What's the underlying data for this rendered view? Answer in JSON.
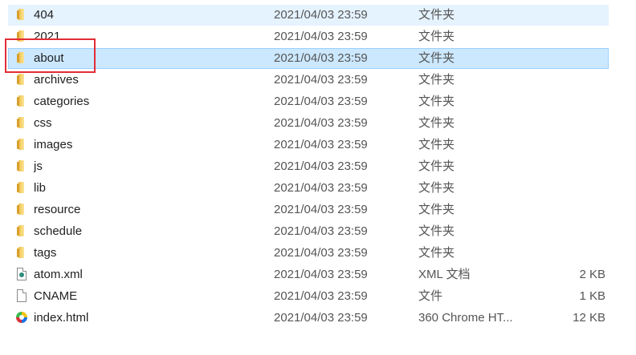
{
  "files": [
    {
      "name": "404",
      "date": "2021/04/03 23:59",
      "type": "文件夹",
      "size": "",
      "icon": "folder-icon",
      "state": "hover"
    },
    {
      "name": "2021",
      "date": "2021/04/03 23:59",
      "type": "文件夹",
      "size": "",
      "icon": "folder-icon",
      "state": ""
    },
    {
      "name": "about",
      "date": "2021/04/03 23:59",
      "type": "文件夹",
      "size": "",
      "icon": "folder-icon",
      "state": "selected"
    },
    {
      "name": "archives",
      "date": "2021/04/03 23:59",
      "type": "文件夹",
      "size": "",
      "icon": "folder-icon",
      "state": ""
    },
    {
      "name": "categories",
      "date": "2021/04/03 23:59",
      "type": "文件夹",
      "size": "",
      "icon": "folder-icon",
      "state": ""
    },
    {
      "name": "css",
      "date": "2021/04/03 23:59",
      "type": "文件夹",
      "size": "",
      "icon": "folder-icon",
      "state": ""
    },
    {
      "name": "images",
      "date": "2021/04/03 23:59",
      "type": "文件夹",
      "size": "",
      "icon": "folder-icon",
      "state": ""
    },
    {
      "name": "js",
      "date": "2021/04/03 23:59",
      "type": "文件夹",
      "size": "",
      "icon": "folder-icon",
      "state": ""
    },
    {
      "name": "lib",
      "date": "2021/04/03 23:59",
      "type": "文件夹",
      "size": "",
      "icon": "folder-icon",
      "state": ""
    },
    {
      "name": "resource",
      "date": "2021/04/03 23:59",
      "type": "文件夹",
      "size": "",
      "icon": "folder-icon",
      "state": ""
    },
    {
      "name": "schedule",
      "date": "2021/04/03 23:59",
      "type": "文件夹",
      "size": "",
      "icon": "folder-icon",
      "state": ""
    },
    {
      "name": "tags",
      "date": "2021/04/03 23:59",
      "type": "文件夹",
      "size": "",
      "icon": "folder-icon",
      "state": ""
    },
    {
      "name": "atom.xml",
      "date": "2021/04/03 23:59",
      "type": "XML 文档",
      "size": "2 KB",
      "icon": "xml-file-icon",
      "state": ""
    },
    {
      "name": "CNAME",
      "date": "2021/04/03 23:59",
      "type": "文件",
      "size": "1 KB",
      "icon": "file-icon",
      "state": ""
    },
    {
      "name": "index.html",
      "date": "2021/04/03 23:59",
      "type": "360 Chrome HT...",
      "size": "12 KB",
      "icon": "chrome-html-icon",
      "state": ""
    }
  ],
  "colors": {
    "selected_background": "#cce8ff",
    "selected_border": "#99d1ff",
    "hover_background": "#e5f3ff",
    "annotation_red": "#e32d36",
    "folder_yellow": "#f7d36d"
  }
}
